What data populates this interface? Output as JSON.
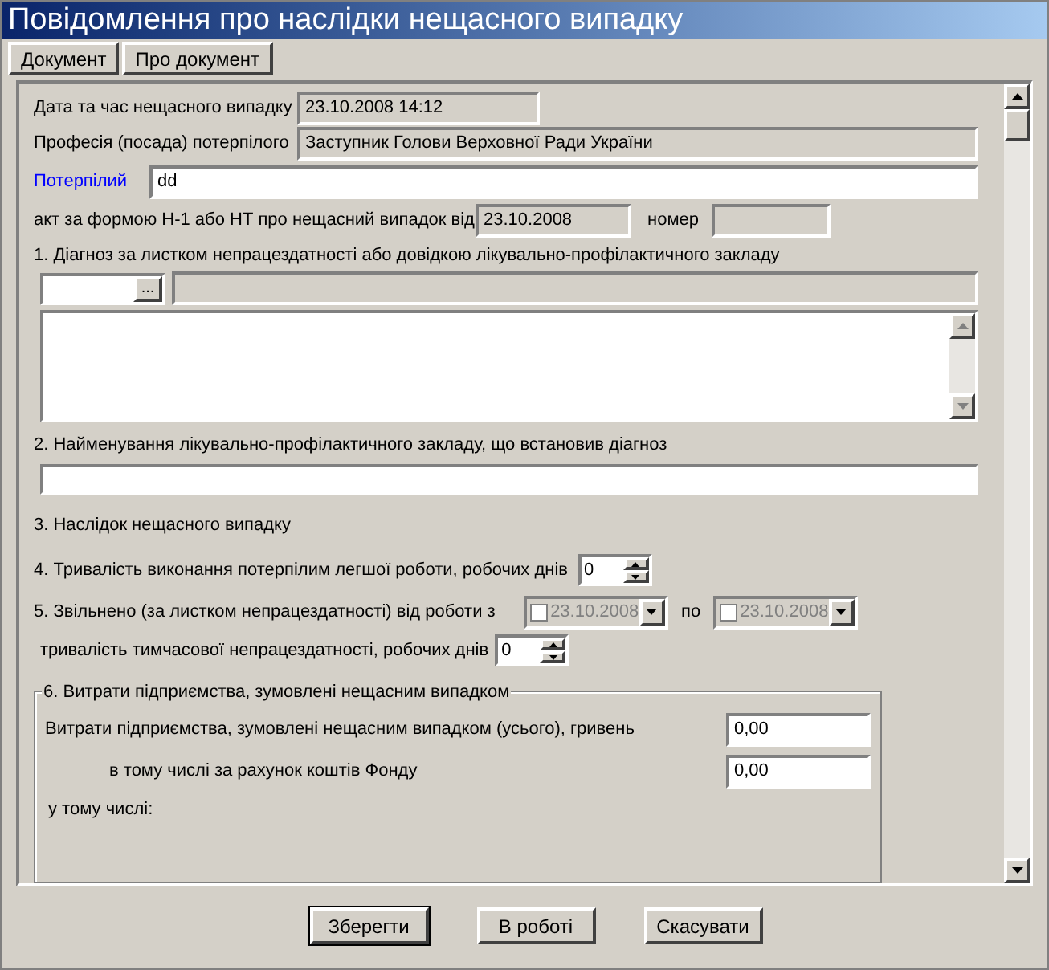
{
  "window": {
    "title": "Повідомлення про наслідки нещасного випадку"
  },
  "toolbar": [
    {
      "label": "Документ"
    },
    {
      "label": "Про документ"
    }
  ],
  "incident": {
    "label": "Дата та час нещасного випадку",
    "value": "23.10.2008 14:12"
  },
  "profession": {
    "label": "Професія (посада) потерпілого",
    "value": "Заступник Голови Верховної Ради України"
  },
  "victim": {
    "label": "Потерпілий",
    "value": "dd"
  },
  "act": {
    "label": "акт за формою Н-1 або НТ про нещасний випадок від",
    "date": "23.10.2008",
    "number_label": "номер"
  },
  "diagnosis": {
    "label": "1. Діагноз за листком непрацездатності або довідкою лікувально-профілактичного закладу",
    "browse": "..."
  },
  "clinic": {
    "label": "2. Найменування лікувально-профілактичного закладу, що встановив діагноз"
  },
  "consequence": {
    "label": "3. Наслідок нещасного випадку"
  },
  "light_work": {
    "label": "4. Тривалість виконання потерпілим легшої роботи, робочих днів",
    "value": "0"
  },
  "released": {
    "label": "5. Звільнено (за листком непрацездатності) від роботи з",
    "to_label": "по",
    "from": {
      "value": "23.10.2008",
      "checked": false
    },
    "to": {
      "value": "23.10.2008",
      "checked": false
    }
  },
  "disability": {
    "label": "тривалість тимчасової непрацездатності, робочих днів",
    "value": "0"
  },
  "costs": {
    "title": "6. Витрати підприємства, зумовлені нещасним випадком",
    "total": {
      "label": "Витрати підприємства, зумовлені нещасним випадком (усього), гривень",
      "value": "0,00"
    },
    "from_fund": {
      "label": "в тому числі за рахунок коштів Фонду",
      "value": "0,00"
    },
    "subheading": "у тому числі:"
  },
  "buttons": [
    {
      "label": "Зберегти",
      "default": true
    },
    {
      "label": "В роботі",
      "default": false
    },
    {
      "label": "Скасувати",
      "default": false
    }
  ]
}
